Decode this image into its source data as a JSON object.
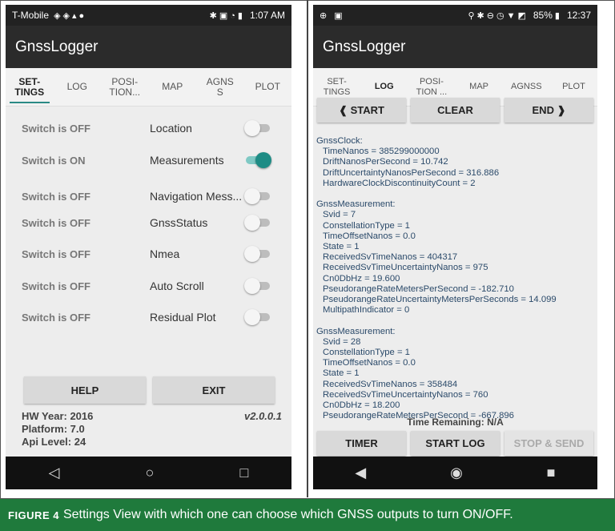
{
  "left": {
    "status": {
      "carrier": "T-Mobile",
      "time": "1:07 AM"
    },
    "app_title": "GnssLogger",
    "tabs": [
      "SET-\nTINGS",
      "LOG",
      "POSI-\nTION...",
      "MAP",
      "AGNS\nS",
      "PLOT"
    ],
    "settings": [
      {
        "status": "Switch is OFF",
        "name": "Location",
        "on": false
      },
      {
        "status": "Switch is ON",
        "name": "Measurements",
        "on": true
      },
      {
        "status": "Switch is OFF",
        "name": "Navigation Mess...",
        "on": false
      },
      {
        "status": "Switch is OFF",
        "name": "GnssStatus",
        "on": false
      },
      {
        "status": "Switch is OFF",
        "name": "Nmea",
        "on": false
      },
      {
        "status": "Switch is OFF",
        "name": "Auto Scroll",
        "on": false
      },
      {
        "status": "Switch is OFF",
        "name": "Residual Plot",
        "on": false
      }
    ],
    "help_label": "HELP",
    "exit_label": "EXIT",
    "hw_year": "HW Year: 2016",
    "platform": "Platform: 7.0",
    "api_level": "Api Level: 24",
    "version": "v2.0.0.1"
  },
  "right": {
    "status": {
      "battery": "85%",
      "time": "12:37"
    },
    "app_title": "GnssLogger",
    "tabs": [
      "SET-\nTINGS",
      "LOG",
      "POSI-\nTION ...",
      "MAP",
      "AGNSS",
      "PLOT"
    ],
    "start_label": "❰ START",
    "clear_label": "CLEAR",
    "end_label": "END ❱",
    "log_lines": [
      "GnssClock:",
      "  TimeNanos = 385299000000",
      "  DriftNanosPerSecond = 10.742",
      "  DriftUncertaintyNanosPerSecond = 316.886",
      "  HardwareClockDiscontinuityCount = 2",
      "",
      "GnssMeasurement:",
      "  Svid = 7",
      "  ConstellationType = 1",
      "  TimeOffsetNanos = 0.0",
      "  State = 1",
      "  ReceivedSvTimeNanos = 404317",
      "  ReceivedSvTimeUncertaintyNanos = 975",
      "  Cn0DbHz = 19.600",
      "  PseudorangeRateMetersPerSecond = -182.710",
      "  PseudorangeRateUncertaintyMetersPerSeconds = 14.099",
      "  MultipathIndicator = 0",
      "",
      "GnssMeasurement:",
      "  Svid = 28",
      "  ConstellationType = 1",
      "  TimeOffsetNanos = 0.0",
      "  State = 1",
      "  ReceivedSvTimeNanos = 358484",
      "  ReceivedSvTimeUncertaintyNanos = 760",
      "  Cn0DbHz = 18.200",
      "  PseudorangeRateMetersPerSecond = -667.896"
    ],
    "time_remaining": "Time Remaining: N/A",
    "timer_label": "TIMER",
    "start_log_label": "START LOG",
    "stop_send_label": "STOP & SEND"
  },
  "caption": {
    "figure": "FIGURE 4",
    "text": "Settings View with which one can choose which GNSS outputs to turn ON/OFF."
  },
  "colors": {
    "accent": "#1e8c85",
    "caption_bg": "#1f7a3c",
    "log_text": "#2b4a6a"
  }
}
